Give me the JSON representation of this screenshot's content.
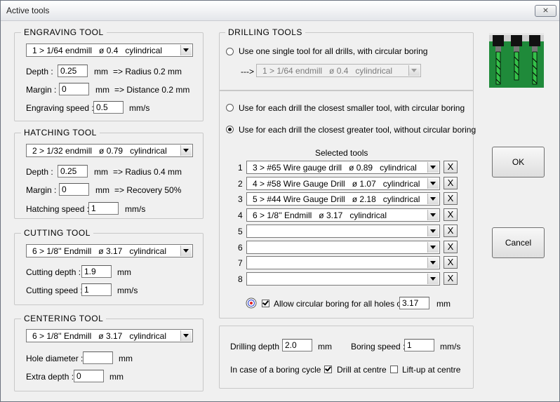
{
  "window": {
    "title": "Active tools",
    "close_label": "⨯"
  },
  "engraving": {
    "legend": "ENGRAVING  TOOL",
    "tool": "1 > 1/64 endmill   ø 0.4   cylindrical",
    "depth_label": "Depth :",
    "depth_value": "0.25",
    "depth_unit": "mm",
    "depth_note": "=> Radius 0.2 mm",
    "margin_label": "Margin :",
    "margin_value": "0",
    "margin_unit": "mm",
    "margin_note": "=> Distance 0.2 mm",
    "speed_label": "Engraving speed :",
    "speed_value": "0.5",
    "speed_unit": "mm/s"
  },
  "hatching": {
    "legend": "HATCHING  TOOL",
    "tool": "2 > 1/32 endmill   ø 0.79   cylindrical",
    "depth_label": "Depth :",
    "depth_value": "0.25",
    "depth_unit": "mm",
    "depth_note": "=> Radius 0.4 mm",
    "margin_label": "Margin :",
    "margin_value": "0",
    "margin_unit": "mm",
    "margin_note": "=> Recovery 50%",
    "speed_label": "Hatching speed :",
    "speed_value": "1",
    "speed_unit": "mm/s"
  },
  "cutting": {
    "legend": "CUTTING  TOOL",
    "tool": "6 > 1/8'' Endmill   ø 3.17   cylindrical",
    "depth_label": "Cutting depth :",
    "depth_value": "1.9",
    "depth_unit": "mm",
    "speed_label": "Cutting speed :",
    "speed_value": "1",
    "speed_unit": "mm/s"
  },
  "centering": {
    "legend": "CENTERING  TOOL",
    "tool": "6 > 1/8'' Endmill   ø 3.17   cylindrical",
    "hole_label": "Hole diameter :",
    "hole_value": "",
    "hole_unit": "mm",
    "extra_label": "Extra depth :",
    "extra_value": "0",
    "extra_unit": "mm"
  },
  "drilling": {
    "legend": "DRILLING  TOOLS",
    "option_single": "Use one single tool for all drills, with circular boring",
    "single_arrow": "--->",
    "single_tool": "1 > 1/64 endmill   ø 0.4   cylindrical",
    "option_smaller": "Use for each drill the closest smaller tool, with circular boring",
    "option_greater": "Use for each drill the closest greater tool, without circular boring",
    "selected_title": "Selected tools",
    "tools": [
      {
        "num": "1",
        "value": "3 > #65 Wire gauge drill   ø 0.89   cylindrical"
      },
      {
        "num": "2",
        "value": "4 > #58 Wire Gauge Drill   ø 1.07   cylindrical"
      },
      {
        "num": "3",
        "value": "5 > #44 Wire Gauge Drill   ø 2.18   cylindrical"
      },
      {
        "num": "4",
        "value": "6 > 1/8'' Endmill   ø 3.17   cylindrical"
      },
      {
        "num": "5",
        "value": ""
      },
      {
        "num": "6",
        "value": ""
      },
      {
        "num": "7",
        "value": ""
      },
      {
        "num": "8",
        "value": ""
      }
    ],
    "remove_label": "X",
    "allow_label": "Allow circular boring for all holes over",
    "allow_value": "3.17",
    "allow_unit": "mm",
    "depth_label": "Drilling depth :",
    "depth_value": "2.0",
    "depth_unit": "mm",
    "boring_label": "Boring speed :",
    "boring_value": "1",
    "boring_unit": "mm/s",
    "cycle_label": "In case of a boring cycle :",
    "drill_centre": "Drill at centre",
    "liftup_centre": "Lift-up at centre"
  },
  "buttons": {
    "ok": "OK",
    "cancel": "Cancel"
  },
  "colors": {
    "pcb_green": "#1f8a3a",
    "drill_green": "#35c24a"
  }
}
